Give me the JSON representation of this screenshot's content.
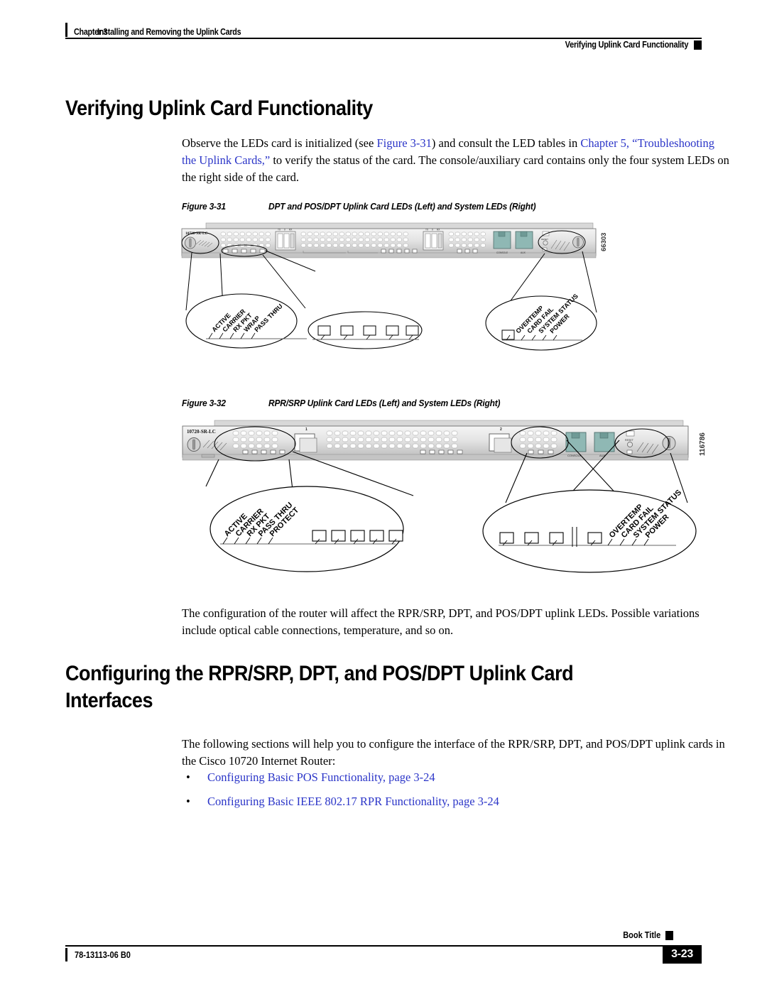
{
  "header": {
    "chapter_label": "Chapter 3",
    "chapter_title": "Installing and Removing the Uplink Cards",
    "running_head": "Verifying Uplink Card Functionality"
  },
  "section1": {
    "heading": "Verifying Uplink Card Functionality",
    "paragraph_part1": "Observe the LEDs card is initialized (see ",
    "paragraph_link1": "Figure 3-31",
    "paragraph_part2": ") and consult the LED tables in ",
    "paragraph_link2": "Chapter 5, “Troubleshooting the Uplink Cards,”",
    "paragraph_part3": " to verify the status of the card. The console/auxiliary card contains only the four system LEDs on the right side of the card."
  },
  "figure_331": {
    "caption_number": "Figure 3-31",
    "caption_text": "DPT and POS/DPT Uplink Card LEDs (Left) and System LEDs (Right)",
    "card_label": "10720-SR-LC",
    "art_id": "66303",
    "port_labels": [
      "CONSOLE",
      "AUX"
    ],
    "left_led_labels": [
      "ACTIVE",
      "CARRIER",
      "RX PKT",
      "WRAP",
      "PASS THRU"
    ],
    "right_led_labels": [
      "OVERTEMP",
      "CARD FAIL",
      "SYSTEM STATUS",
      "POWER"
    ],
    "left_callout_led_count": 5,
    "right_callout_led_count": 1,
    "reset_label": "RESET"
  },
  "figure_332": {
    "caption_number": "Figure 3-32",
    "caption_text": "RPR/SRP Uplink Card LEDs (Left) and System LEDs (Right)",
    "card_label": "10720-SR-LC",
    "art_id": "116786",
    "port_labels": [
      "CONSOLE",
      "AUX"
    ],
    "slot_labels": [
      "1",
      "2"
    ],
    "left_led_labels": [
      "ACTIVE",
      "CARRIER",
      "RX PKT",
      "PASS THRU",
      "PROTECT"
    ],
    "right_led_labels": [
      "OVERTEMP",
      "CARD FAIL",
      "SYSTEM STATUS",
      "POWER"
    ],
    "left_callout_led_count": 5,
    "right_callout_led_count": 4,
    "reset_label": "RESET"
  },
  "section1_closing_paragraph": "The configuration of the router will affect the RPR/SRP, DPT, and POS/DPT uplink LEDs. Possible variations include optical cable connections, temperature, and so on.",
  "section2": {
    "heading_line1": "Configuring the RPR/SRP, DPT, and POS/DPT Uplink Card",
    "heading_line2": "Interfaces",
    "paragraph": "The following sections will help you to configure the interface of the RPR/SRP, DPT, and POS/DPT uplink cards in the Cisco 10720 Internet Router:",
    "bullet_marker": "•",
    "bullets": [
      "Configuring Basic POS Functionality, page 3-24",
      "Configuring Basic IEEE 802.17 RPR Functionality, page 3-24"
    ]
  },
  "footer": {
    "book_title": "Book Title",
    "doc_id": "78-13113-06 B0",
    "page_number": "3-23"
  },
  "colors": {
    "link": "#2b35c8",
    "text": "#000000",
    "rule": "#000000",
    "faceplate_light": "#e9e9e9",
    "faceplate_mid": "#c9c9c9",
    "port_teal": "#8fb8b4"
  }
}
